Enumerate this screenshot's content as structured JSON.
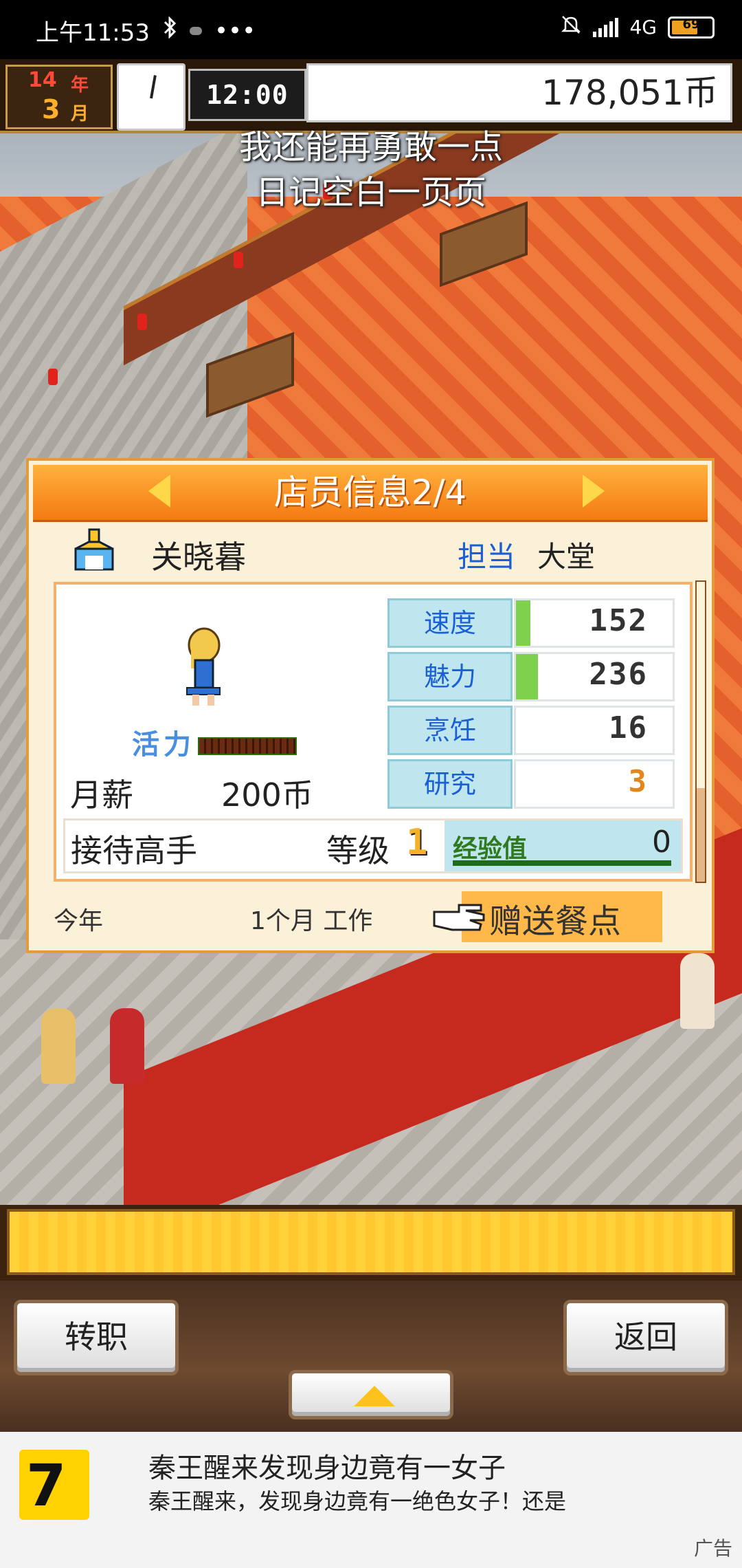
{
  "status_bar": {
    "time": "上午11:53",
    "network": "4G",
    "battery": "69",
    "more": "•••",
    "icons": [
      "bluetooth-icon",
      "app-icon",
      "mute-icon",
      "signal-icon",
      "battery-icon"
    ]
  },
  "hud": {
    "year_num": "14",
    "year_label": "年",
    "month_num": "3",
    "month_label": "月",
    "time": "12:00",
    "money": "178,051币"
  },
  "subtitles": [
    "我还能再勇敢一点",
    "日记空白一页页"
  ],
  "panel": {
    "title": "店员信息2/4",
    "name": "关晓暮",
    "role_label": "担当",
    "role_value": "大堂",
    "vitality_label": "活力",
    "salary_label": "月薪",
    "salary_value": "200币",
    "stats": [
      {
        "name": "速度",
        "value": "152",
        "bar": 0.09
      },
      {
        "name": "魅力",
        "value": "236",
        "bar": 0.14
      },
      {
        "name": "烹饪",
        "value": "16",
        "bar": 0
      },
      {
        "name": "研究",
        "value": "3",
        "bar": 0
      }
    ],
    "skill_name": "接待高手",
    "level_label": "等级",
    "level_value": "1",
    "exp_label": "经验值",
    "exp_value": "0",
    "footer_year": "今年",
    "footer_work": "1个月 工作",
    "gift_button": "赠送餐点"
  },
  "controls": {
    "transfer": "转职",
    "back": "返回"
  },
  "ad": {
    "title": "秦王醒来发现身边竟有一女子",
    "desc": "秦王醒来，发现身边竟有一绝色女子！还是",
    "mark": "广告"
  },
  "colors": {
    "panel_header": "#f47a12",
    "stat_label_bg": "#bfe6ee",
    "stat_bar": "#7fd04d",
    "role_label": "#1a5fd6",
    "gift_button": "#ffb84a"
  }
}
